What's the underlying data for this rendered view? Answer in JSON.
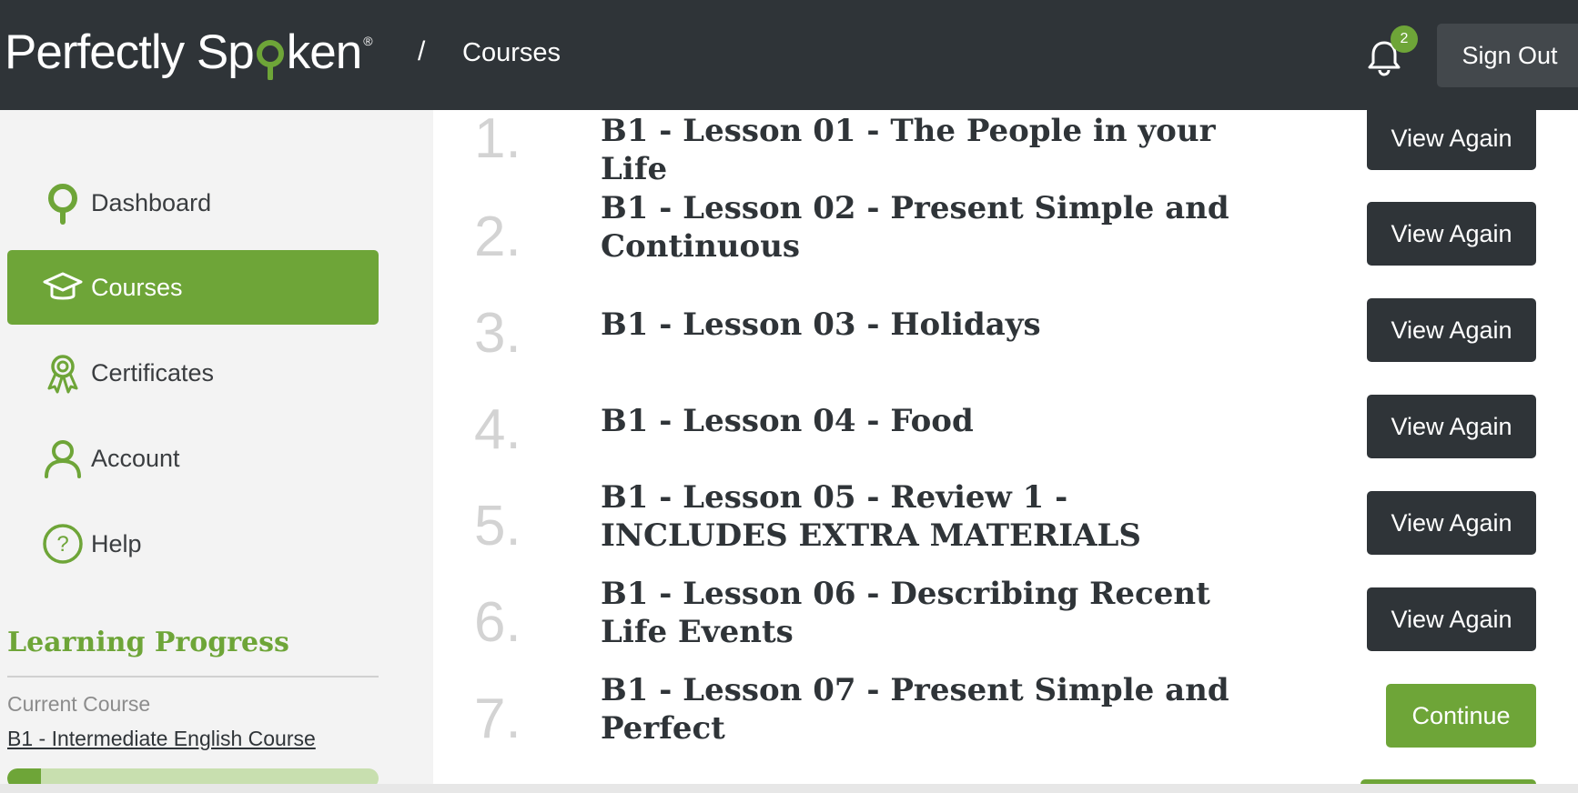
{
  "header": {
    "logo_text_a": "Perfectly Sp",
    "logo_text_b": "ken",
    "logo_reg": "®",
    "breadcrumb_sep": "/",
    "breadcrumb_current": "Courses",
    "notification_count": "2",
    "sign_out_label": "Sign Out"
  },
  "sidebar": {
    "items": [
      {
        "label": "Dashboard",
        "icon": "map-pin-icon"
      },
      {
        "label": "Courses",
        "icon": "graduation-cap-icon",
        "active": true
      },
      {
        "label": "Certificates",
        "icon": "award-ribbon-icon"
      },
      {
        "label": "Account",
        "icon": "user-icon"
      },
      {
        "label": "Help",
        "icon": "question-circle-icon"
      }
    ],
    "learning_progress": {
      "title": "Learning Progress",
      "current_label": "Current Course",
      "current_course": "B1 - Intermediate English Course",
      "progress_fraction": 0.09
    }
  },
  "lessons": [
    {
      "number": "1.",
      "title": "B1 - Lesson 01 - The People in your Life",
      "action": "View Again"
    },
    {
      "number": "2.",
      "title": "B1 - Lesson 02 - Present Simple and Continuous",
      "action": "View Again"
    },
    {
      "number": "3.",
      "title": "B1 - Lesson 03 - Holidays",
      "action": "View Again"
    },
    {
      "number": "4.",
      "title": "B1 - Lesson 04 - Food",
      "action": "View Again"
    },
    {
      "number": "5.",
      "title": "B1 - Lesson 05 - Review 1 - INCLUDES EXTRA MATERIALS",
      "action": "View Again"
    },
    {
      "number": "6.",
      "title": "B1 - Lesson 06 - Describing Recent Life Events",
      "action": "View Again"
    },
    {
      "number": "7.",
      "title": "B1 - Lesson 07 - Present Simple and Perfect",
      "action": "Continue"
    }
  ],
  "colors": {
    "brand_green": "#6ea538",
    "header_dark": "#2f3438",
    "progress_track": "#c8dfaf"
  }
}
